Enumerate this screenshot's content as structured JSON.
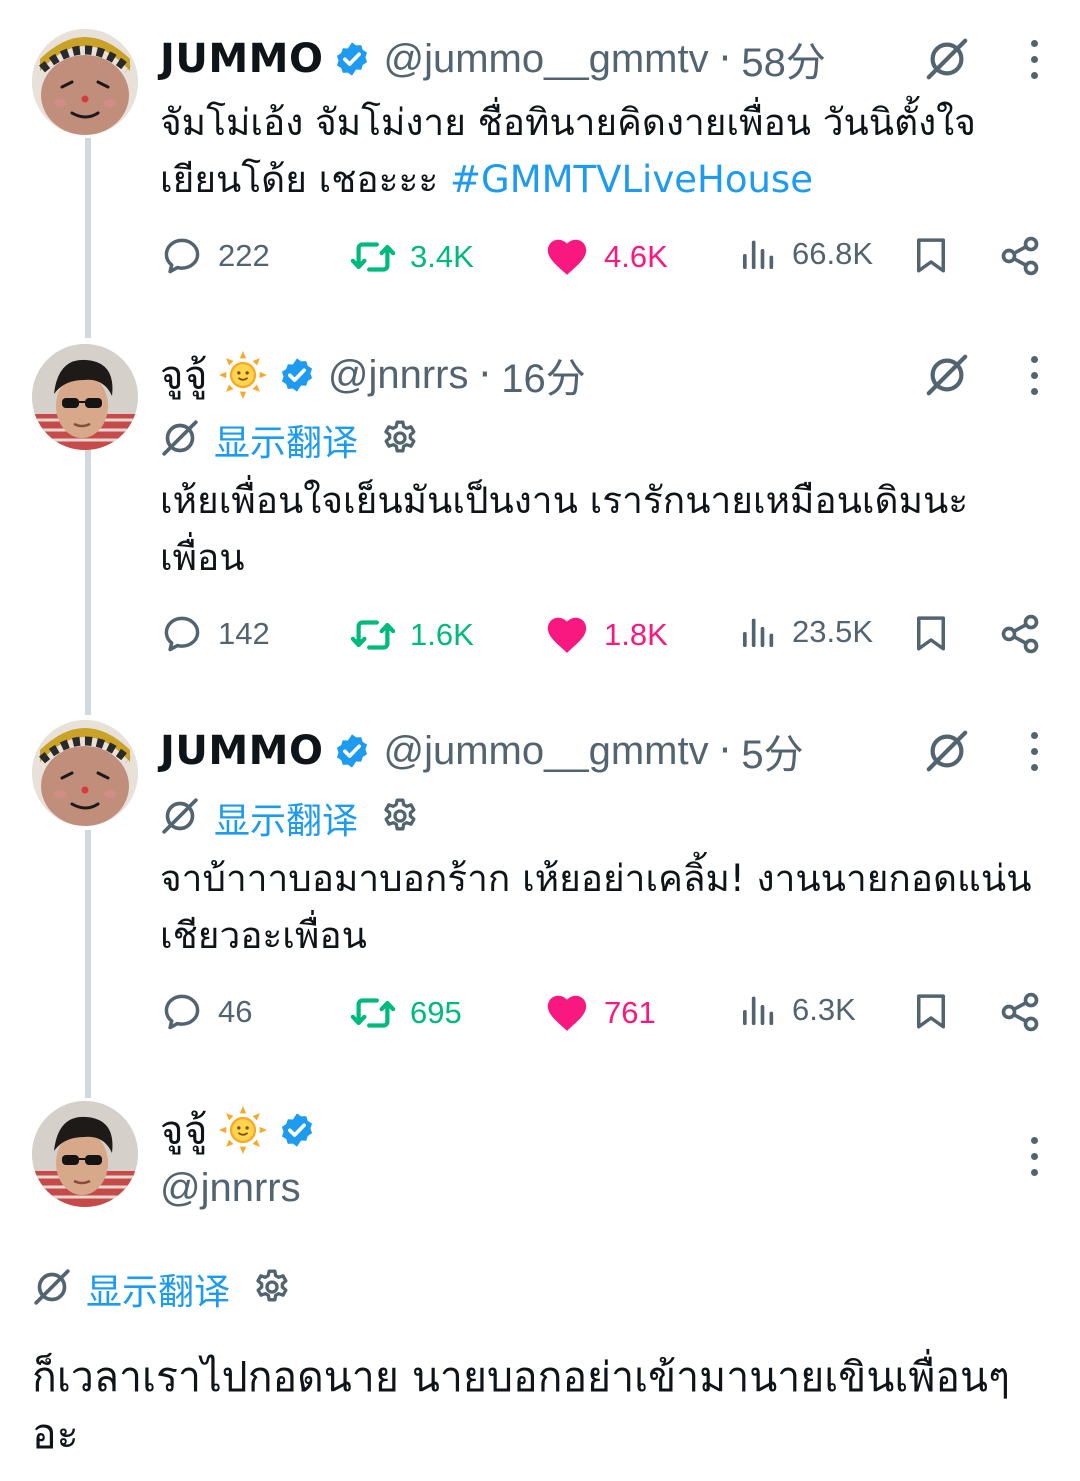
{
  "tweets": [
    {
      "name": "JUMMO",
      "handle": "@jummo__gmmtv",
      "sep": "·",
      "time": "58分",
      "text": "จัมโม่เอ้ง จัมโม่งาย ชื่อทินายคิดงายเพื่อน วันนิตั้งใจเยียนโด้ย เชอะะะ ",
      "hashtag": "#GMMTVLiveHouse",
      "replies": "222",
      "retweets": "3.4K",
      "likes": "4.6K",
      "views": "66.8K"
    },
    {
      "name": "จูจู้",
      "handle": "@jnnrrs",
      "sep": "·",
      "time": "16分",
      "translate": "显示翻译",
      "text": "เห้ยเพื่อนใจเย็นมันเป็นงาน เรารักนายเหมือนเดิมนะเพื่อน",
      "replies": "142",
      "retweets": "1.6K",
      "likes": "1.8K",
      "views": "23.5K"
    },
    {
      "name": "JUMMO",
      "handle": "@jummo__gmmtv",
      "sep": "·",
      "time": "5分",
      "translate": "显示翻译",
      "text": "จาบ้าาาบอมาบอกร้าก เห้ยอย่าเคลิ้ม! งานนายกอดแน่นเชียวอะเพื่อน",
      "replies": "46",
      "retweets": "695",
      "likes": "761",
      "views": "6.3K"
    },
    {
      "name": "จูจู้",
      "handle": "@jnnrrs",
      "translate": "显示翻译",
      "text": "ก็เวลาเราไปกอดนาย นายบอกอย่าเข้ามานายเขินเพื่อนๆอะ"
    }
  ],
  "colors": {
    "accent": "#1d9bf0",
    "retweet": "#00ba7c",
    "like": "#f91880",
    "muted": "#536471",
    "thread_line": "#cfd9de"
  },
  "icons": [
    "reply-icon",
    "retweet-icon",
    "heart-icon",
    "views-icon",
    "bookmark-icon",
    "share-icon",
    "grok-icon",
    "more-icon",
    "verified-icon",
    "translate-icon",
    "gear-icon",
    "sun-emoji"
  ]
}
